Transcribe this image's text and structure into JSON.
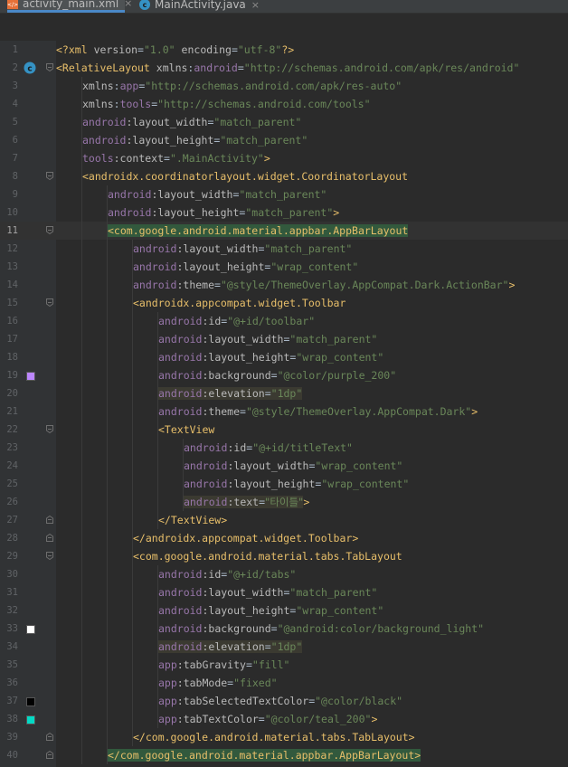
{
  "tabs": [
    {
      "label": "activity_main.xml",
      "active": true,
      "icon": "xml-file-icon"
    },
    {
      "label": "MainActivity.java",
      "active": false,
      "icon": "java-class-icon"
    }
  ],
  "close_glyph": "×",
  "colors": {
    "editor_bg": "#2b2b2b",
    "gutter_bg": "#313335",
    "tag": "#e8bf6a",
    "namespace": "#9876aa",
    "value": "#6a8759",
    "purple_200_swatch": "#bb86fc",
    "white_swatch": "#ffffff",
    "black_swatch": "#000000",
    "teal_200_swatch": "#03dac5"
  },
  "editor": {
    "caret_line": 11,
    "lines": [
      {
        "n": "1",
        "indent": 0,
        "tokens": [
          [
            "t-punct",
            "<?"
          ],
          [
            "t-tag",
            "xml"
          ],
          [
            "t-plain",
            " "
          ],
          [
            "t-attr",
            "version"
          ],
          [
            "t-plain",
            "="
          ],
          [
            "t-val",
            "\"1.0\""
          ],
          [
            "t-plain",
            " "
          ],
          [
            "t-attr",
            "encoding"
          ],
          [
            "t-plain",
            "="
          ],
          [
            "t-val",
            "\"utf-8\""
          ],
          [
            "t-punct",
            "?>"
          ]
        ]
      },
      {
        "n": "2",
        "indent": 0,
        "gicon": "class-c-icon",
        "fold": true,
        "tokens": [
          [
            "t-tag",
            "<RelativeLayout"
          ],
          [
            "t-plain",
            " "
          ],
          [
            "t-attr",
            "xmlns"
          ],
          [
            "t-plain",
            ":"
          ],
          [
            "t-ns",
            "android"
          ],
          [
            "t-plain",
            "="
          ],
          [
            "t-val",
            "\"http://schemas.android.com/apk/res/android\""
          ]
        ]
      },
      {
        "n": "3",
        "indent": 1,
        "tokens": [
          [
            "t-attr",
            "xmlns"
          ],
          [
            "t-plain",
            ":"
          ],
          [
            "t-ns",
            "app"
          ],
          [
            "t-plain",
            "="
          ],
          [
            "t-val",
            "\"http://schemas.android.com/apk/res-auto\""
          ]
        ]
      },
      {
        "n": "4",
        "indent": 1,
        "tokens": [
          [
            "t-attr",
            "xmlns"
          ],
          [
            "t-plain",
            ":"
          ],
          [
            "t-ns",
            "tools"
          ],
          [
            "t-plain",
            "="
          ],
          [
            "t-val",
            "\"http://schemas.android.com/tools\""
          ]
        ]
      },
      {
        "n": "5",
        "indent": 1,
        "tokens": [
          [
            "t-ns",
            "android"
          ],
          [
            "t-attr",
            ":layout_width"
          ],
          [
            "t-plain",
            "="
          ],
          [
            "t-val",
            "\"match_parent\""
          ]
        ]
      },
      {
        "n": "6",
        "indent": 1,
        "tokens": [
          [
            "t-ns",
            "android"
          ],
          [
            "t-attr",
            ":layout_height"
          ],
          [
            "t-plain",
            "="
          ],
          [
            "t-val",
            "\"match_parent\""
          ]
        ]
      },
      {
        "n": "7",
        "indent": 1,
        "tokens": [
          [
            "t-ns",
            "tools"
          ],
          [
            "t-attr",
            ":context"
          ],
          [
            "t-plain",
            "="
          ],
          [
            "t-val",
            "\".MainActivity\""
          ],
          [
            "t-tag",
            ">"
          ]
        ]
      },
      {
        "n": "8",
        "indent": 1,
        "fold": true,
        "tokens": [
          [
            "t-tag",
            "<androidx.coordinatorlayout.widget.CoordinatorLayout"
          ]
        ]
      },
      {
        "n": "9",
        "indent": 2,
        "tokens": [
          [
            "t-ns",
            "android"
          ],
          [
            "t-attr",
            ":layout_width"
          ],
          [
            "t-plain",
            "="
          ],
          [
            "t-val",
            "\"match_parent\""
          ]
        ]
      },
      {
        "n": "10",
        "indent": 2,
        "tokens": [
          [
            "t-ns",
            "android"
          ],
          [
            "t-attr",
            ":layout_height"
          ],
          [
            "t-plain",
            "="
          ],
          [
            "t-val",
            "\"match_parent\""
          ],
          [
            "t-tag",
            ">"
          ]
        ]
      },
      {
        "n": "11",
        "indent": 2,
        "fold": true,
        "tokens": [
          [
            "t-tag hl-green",
            "<com.google.android.material.appbar.AppBarLayout"
          ]
        ]
      },
      {
        "n": "12",
        "indent": 3,
        "tokens": [
          [
            "t-ns",
            "android"
          ],
          [
            "t-attr",
            ":layout_width"
          ],
          [
            "t-plain",
            "="
          ],
          [
            "t-val",
            "\"match_parent\""
          ]
        ]
      },
      {
        "n": "13",
        "indent": 3,
        "tokens": [
          [
            "t-ns",
            "android"
          ],
          [
            "t-attr",
            ":layout_height"
          ],
          [
            "t-plain",
            "="
          ],
          [
            "t-val",
            "\"wrap_content\""
          ]
        ]
      },
      {
        "n": "14",
        "indent": 3,
        "tokens": [
          [
            "t-ns",
            "android"
          ],
          [
            "t-attr",
            ":theme"
          ],
          [
            "t-plain",
            "="
          ],
          [
            "t-val",
            "\"@style/ThemeOverlay.AppCompat.Dark.ActionBar\""
          ],
          [
            "t-tag",
            ">"
          ]
        ]
      },
      {
        "n": "15",
        "indent": 3,
        "fold": true,
        "tokens": [
          [
            "t-tag",
            "<androidx.appcompat.widget.Toolbar"
          ]
        ]
      },
      {
        "n": "16",
        "indent": 4,
        "tokens": [
          [
            "t-ns",
            "android"
          ],
          [
            "t-attr",
            ":id"
          ],
          [
            "t-plain",
            "="
          ],
          [
            "t-val",
            "\"@+id/toolbar\""
          ]
        ]
      },
      {
        "n": "17",
        "indent": 4,
        "tokens": [
          [
            "t-ns",
            "android"
          ],
          [
            "t-attr",
            ":layout_width"
          ],
          [
            "t-plain",
            "="
          ],
          [
            "t-val",
            "\"match_parent\""
          ]
        ]
      },
      {
        "n": "18",
        "indent": 4,
        "tokens": [
          [
            "t-ns",
            "android"
          ],
          [
            "t-attr",
            ":layout_height"
          ],
          [
            "t-plain",
            "="
          ],
          [
            "t-val",
            "\"wrap_content\""
          ]
        ]
      },
      {
        "n": "19",
        "indent": 4,
        "swatch": "#bb86fc",
        "tokens": [
          [
            "t-ns",
            "android"
          ],
          [
            "t-attr",
            ":background"
          ],
          [
            "t-plain",
            "="
          ],
          [
            "t-val",
            "\"@color/purple_200\""
          ]
        ]
      },
      {
        "n": "20",
        "indent": 4,
        "tokens": [
          [
            "t-ns hl-dark",
            "android"
          ],
          [
            "t-attr hl-dark",
            ":elevation"
          ],
          [
            "t-plain hl-dark",
            "="
          ],
          [
            "t-val hl-dark",
            "\"1dp\""
          ]
        ]
      },
      {
        "n": "21",
        "indent": 4,
        "tokens": [
          [
            "t-ns",
            "android"
          ],
          [
            "t-attr",
            ":theme"
          ],
          [
            "t-plain",
            "="
          ],
          [
            "t-val",
            "\"@style/ThemeOverlay.AppCompat.Dark\""
          ],
          [
            "t-tag",
            ">"
          ]
        ]
      },
      {
        "n": "22",
        "indent": 4,
        "fold": true,
        "tokens": [
          [
            "t-tag",
            "<TextView"
          ]
        ]
      },
      {
        "n": "23",
        "indent": 5,
        "tokens": [
          [
            "t-ns",
            "android"
          ],
          [
            "t-attr",
            ":id"
          ],
          [
            "t-plain",
            "="
          ],
          [
            "t-val",
            "\"@+id/titleText\""
          ]
        ]
      },
      {
        "n": "24",
        "indent": 5,
        "tokens": [
          [
            "t-ns",
            "android"
          ],
          [
            "t-attr",
            ":layout_width"
          ],
          [
            "t-plain",
            "="
          ],
          [
            "t-val",
            "\"wrap_content\""
          ]
        ]
      },
      {
        "n": "25",
        "indent": 5,
        "tokens": [
          [
            "t-ns",
            "android"
          ],
          [
            "t-attr",
            ":layout_height"
          ],
          [
            "t-plain",
            "="
          ],
          [
            "t-val",
            "\"wrap_content\""
          ]
        ]
      },
      {
        "n": "26",
        "indent": 5,
        "tokens": [
          [
            "t-ns hl-dark",
            "android"
          ],
          [
            "t-attr hl-dark",
            ":text"
          ],
          [
            "t-plain hl-dark",
            "="
          ],
          [
            "t-kor hl-dark",
            "\"타이틀\""
          ],
          [
            "t-tag",
            ">"
          ]
        ]
      },
      {
        "n": "27",
        "indent": 4,
        "fold": true,
        "tokens": [
          [
            "t-tag",
            "</TextView>"
          ]
        ]
      },
      {
        "n": "28",
        "indent": 3,
        "fold": true,
        "tokens": [
          [
            "t-tag",
            "</androidx.appcompat.widget.Toolbar>"
          ]
        ]
      },
      {
        "n": "29",
        "indent": 3,
        "fold": true,
        "tokens": [
          [
            "t-tag",
            "<com.google.android.material.tabs.TabLayout"
          ]
        ]
      },
      {
        "n": "30",
        "indent": 4,
        "tokens": [
          [
            "t-ns",
            "android"
          ],
          [
            "t-attr",
            ":id"
          ],
          [
            "t-plain",
            "="
          ],
          [
            "t-val",
            "\"@+id/tabs\""
          ]
        ]
      },
      {
        "n": "31",
        "indent": 4,
        "tokens": [
          [
            "t-ns",
            "android"
          ],
          [
            "t-attr",
            ":layout_width"
          ],
          [
            "t-plain",
            "="
          ],
          [
            "t-val",
            "\"match_parent\""
          ]
        ]
      },
      {
        "n": "32",
        "indent": 4,
        "tokens": [
          [
            "t-ns",
            "android"
          ],
          [
            "t-attr",
            ":layout_height"
          ],
          [
            "t-plain",
            "="
          ],
          [
            "t-val",
            "\"wrap_content\""
          ]
        ]
      },
      {
        "n": "33",
        "indent": 4,
        "swatch": "#ffffff",
        "tokens": [
          [
            "t-ns",
            "android"
          ],
          [
            "t-attr",
            ":background"
          ],
          [
            "t-plain",
            "="
          ],
          [
            "t-val",
            "\"@android:color/background_light\""
          ]
        ]
      },
      {
        "n": "34",
        "indent": 4,
        "tokens": [
          [
            "t-ns hl-dark",
            "android"
          ],
          [
            "t-attr hl-dark",
            ":elevation"
          ],
          [
            "t-plain hl-dark",
            "="
          ],
          [
            "t-val hl-dark",
            "\"1dp\""
          ]
        ]
      },
      {
        "n": "35",
        "indent": 4,
        "tokens": [
          [
            "t-ns",
            "app"
          ],
          [
            "t-attr",
            ":tabGravity"
          ],
          [
            "t-plain",
            "="
          ],
          [
            "t-val",
            "\"fill\""
          ]
        ]
      },
      {
        "n": "36",
        "indent": 4,
        "tokens": [
          [
            "t-ns",
            "app"
          ],
          [
            "t-attr",
            ":tabMode"
          ],
          [
            "t-plain",
            "="
          ],
          [
            "t-val",
            "\"fixed\""
          ]
        ]
      },
      {
        "n": "37",
        "indent": 4,
        "swatch": "#000000",
        "tokens": [
          [
            "t-ns",
            "app"
          ],
          [
            "t-attr",
            ":tabSelectedTextColor"
          ],
          [
            "t-plain",
            "="
          ],
          [
            "t-val",
            "\"@color/black\""
          ]
        ]
      },
      {
        "n": "38",
        "indent": 4,
        "swatch": "#03dac5",
        "tokens": [
          [
            "t-ns",
            "app"
          ],
          [
            "t-attr",
            ":tabTextColor"
          ],
          [
            "t-plain",
            "="
          ],
          [
            "t-val",
            "\"@color/teal_200\""
          ],
          [
            "t-tag",
            ">"
          ]
        ]
      },
      {
        "n": "39",
        "indent": 3,
        "fold": true,
        "tokens": [
          [
            "t-tag",
            "</com.google.android.material.tabs.TabLayout>"
          ]
        ]
      },
      {
        "n": "40",
        "indent": 2,
        "fold": true,
        "tokens": [
          [
            "t-tag hl-green",
            "</com.google.android.material.appbar.AppBarLayout>"
          ]
        ]
      }
    ]
  }
}
